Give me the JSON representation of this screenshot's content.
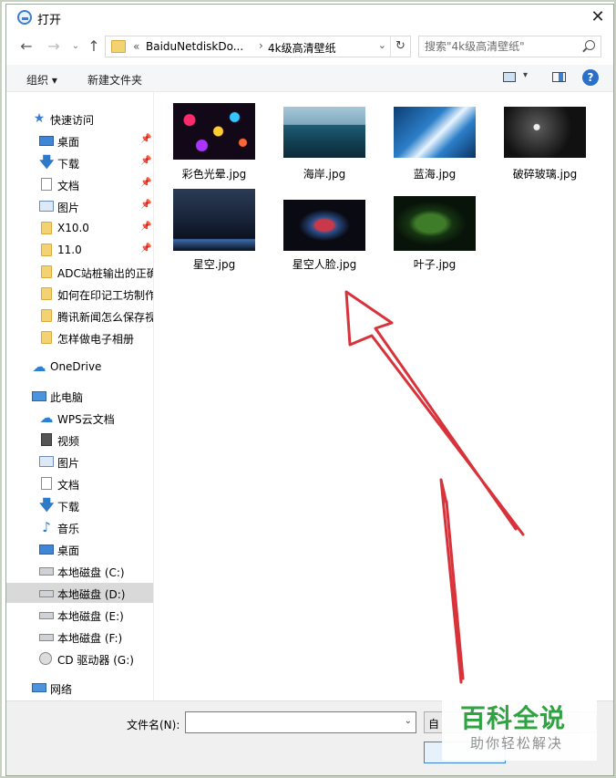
{
  "titlebar": {
    "title": "打开",
    "close_glyph": "✕"
  },
  "nav": {
    "back_glyph": "←",
    "forward_glyph": "→",
    "up_glyph": "↑",
    "chevron_glyph": "⌄"
  },
  "address": {
    "prefix": "«",
    "path": [
      "BaiduNetdiskDo...",
      "4k级高清壁纸"
    ],
    "separator": "›",
    "dropdown_glyph": "⌄",
    "refresh_glyph": "↻"
  },
  "search": {
    "placeholder": "搜索\"4k级高清壁纸\""
  },
  "toolbar": {
    "organize_label": "组织 ▾",
    "new_folder_label": "新建文件夹",
    "view_dropdown_glyph": "▾",
    "help_glyph": "?"
  },
  "sidebar": {
    "pin_glyph": "📌",
    "items": [
      {
        "label": "快速访问",
        "icon": "star-icon",
        "glyph": "★"
      },
      {
        "label": "桌面",
        "icon": "desktop-icon",
        "pinned": true
      },
      {
        "label": "下载",
        "icon": "download-icon",
        "glyph": "🡇",
        "pinned": true
      },
      {
        "label": "文档",
        "icon": "document-icon",
        "pinned": true
      },
      {
        "label": "图片",
        "icon": "pictures-icon",
        "pinned": true
      },
      {
        "label": "X10.0",
        "icon": "folder-icon",
        "pinned": true
      },
      {
        "label": "11.0",
        "icon": "folder-icon",
        "pinned": true
      },
      {
        "label": "ADC站桩输出的正确",
        "icon": "folder-icon"
      },
      {
        "label": "如何在印记工坊制作",
        "icon": "folder-icon"
      },
      {
        "label": "腾讯新闻怎么保存视",
        "icon": "folder-icon"
      },
      {
        "label": "怎样做电子相册",
        "icon": "folder-icon"
      },
      {
        "label": "OneDrive",
        "icon": "onedrive-icon",
        "glyph": "☁"
      },
      {
        "label": "此电脑",
        "icon": "computer-icon"
      },
      {
        "label": "WPS云文档",
        "icon": "wps-cloud-icon",
        "glyph": "☁"
      },
      {
        "label": "视频",
        "icon": "video-icon"
      },
      {
        "label": "图片",
        "icon": "pictures-icon"
      },
      {
        "label": "文档",
        "icon": "document-icon"
      },
      {
        "label": "下载",
        "icon": "download-icon",
        "glyph": "🡇"
      },
      {
        "label": "音乐",
        "icon": "music-icon",
        "glyph": "♪"
      },
      {
        "label": "桌面",
        "icon": "desktop-icon"
      },
      {
        "label": "本地磁盘 (C:)",
        "icon": "drive-c-icon"
      },
      {
        "label": "本地磁盘 (D:)",
        "icon": "drive-icon",
        "selected": true
      },
      {
        "label": "本地磁盘 (E:)",
        "icon": "drive-icon"
      },
      {
        "label": "本地磁盘 (F:)",
        "icon": "drive-icon"
      },
      {
        "label": "CD 驱动器 (G:)",
        "icon": "cd-drive-icon"
      },
      {
        "label": "网络",
        "icon": "network-icon"
      }
    ]
  },
  "files": [
    {
      "name": "彩色光晕.jpg"
    },
    {
      "name": "海岸.jpg"
    },
    {
      "name": "蓝海.jpg"
    },
    {
      "name": "破碎玻璃.jpg"
    },
    {
      "name": "星空.jpg"
    },
    {
      "name": "星空人脸.jpg"
    },
    {
      "name": "叶子.jpg"
    }
  ],
  "bottom": {
    "filename_label": "文件名(N):",
    "filename_value": "",
    "dropdown_glyph": "⌄",
    "filter_label": "自"
  },
  "watermark": {
    "title": "百科全说",
    "subtitle": "助你轻松解决"
  },
  "colors": {
    "accent": "#2a6fc9",
    "arrow": "#d8323a",
    "watermark_green": "#26a03a"
  }
}
